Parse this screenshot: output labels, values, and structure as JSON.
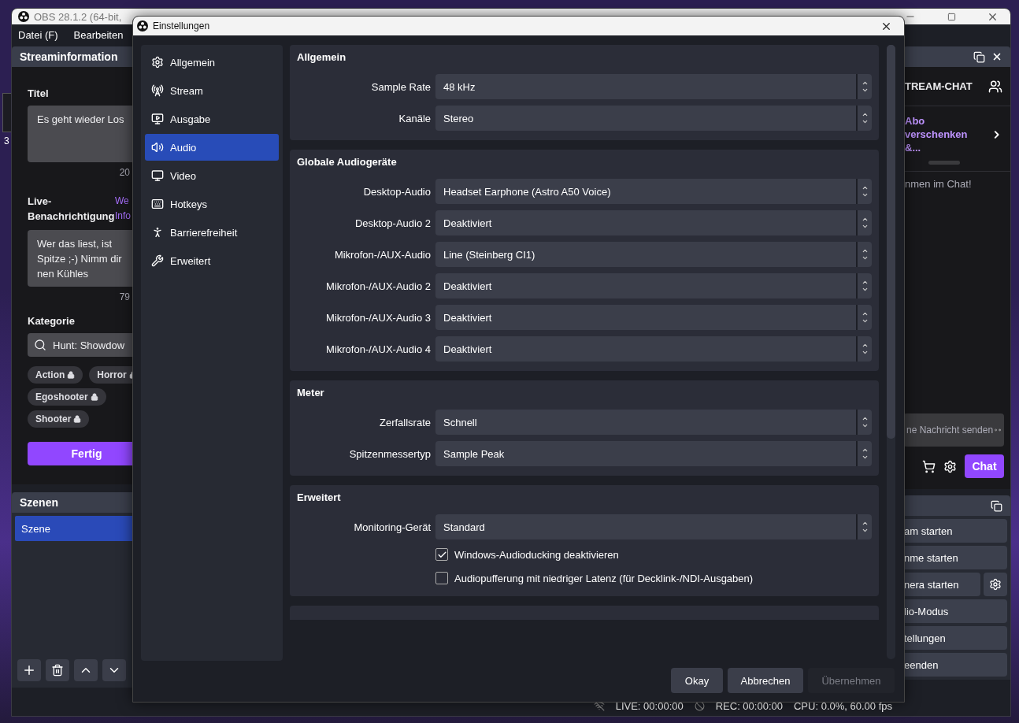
{
  "desktop": {
    "icon_label": "3"
  },
  "obs_window": {
    "title": "OBS 28.1.2 (64-bit,",
    "menu": [
      "Datei (F)",
      "Bearbeiten"
    ],
    "stream_info": {
      "title": "Streaminformation",
      "title_label": "Titel",
      "title_value": "Es geht wieder Los",
      "title_count": "20",
      "notification_label": "Live-Benachrichtigung",
      "notification_links": [
        "We",
        "Info"
      ],
      "notification_value": "Wer das liest, ist Spitze ;-) Nimm dir nen Kühles",
      "notification_count": "79",
      "category_label": "Kategorie",
      "category_value": "Hunt: Showdow",
      "tags": [
        "Action",
        "Horror",
        "Egoshooter",
        "Shooter"
      ],
      "done_button": "Fertig"
    },
    "scenes": {
      "title": "Szenen",
      "items": [
        {
          "label": "Szene",
          "selected": true
        }
      ]
    },
    "chat": {
      "title": "TREAM-CHAT",
      "promo": "Abo verschenken &...",
      "welcome": "nmen im Chat!",
      "placeholder": "ne Nachricht senden",
      "chat_button": "Chat"
    },
    "controls": {
      "buttons": [
        {
          "label": "am starten",
          "has_settings": false
        },
        {
          "label": "nme starten",
          "has_settings": false
        },
        {
          "label": "nera starten",
          "has_settings": true
        },
        {
          "label": "lio-Modus",
          "has_settings": false
        },
        {
          "label": "tellungen",
          "has_settings": false
        },
        {
          "label": "eenden",
          "has_settings": false
        }
      ]
    },
    "status_bar": {
      "live": "LIVE: 00:00:00",
      "rec": "REC: 00:00:00",
      "cpu": "CPU: 0.0%, 60.00 fps"
    }
  },
  "dialog": {
    "title": "Einstellungen",
    "sidebar": [
      {
        "label": "Allgemein",
        "kind": "gear",
        "selected": false
      },
      {
        "label": "Stream",
        "kind": "antenna",
        "selected": false
      },
      {
        "label": "Ausgabe",
        "kind": "output",
        "selected": false
      },
      {
        "label": "Audio",
        "kind": "speaker",
        "selected": true
      },
      {
        "label": "Video",
        "kind": "monitor",
        "selected": false
      },
      {
        "label": "Hotkeys",
        "kind": "keyboard",
        "selected": false
      },
      {
        "label": "Barrierefreiheit",
        "kind": "accessibility",
        "selected": false
      },
      {
        "label": "Erweitert",
        "kind": "tools",
        "selected": false
      }
    ],
    "sections": [
      {
        "title": "Allgemein",
        "rows": [
          {
            "kind": "select",
            "label": "Sample Rate",
            "value": "48 kHz"
          },
          {
            "kind": "select",
            "label": "Kanäle",
            "value": "Stereo"
          }
        ]
      },
      {
        "title": "Globale Audiogeräte",
        "rows": [
          {
            "kind": "select",
            "label": "Desktop-Audio",
            "value": "Headset Earphone (Astro A50 Voice)"
          },
          {
            "kind": "select",
            "label": "Desktop-Audio 2",
            "value": "Deaktiviert"
          },
          {
            "kind": "select",
            "label": "Mikrofon-/AUX-Audio",
            "value": "Line (Steinberg CI1)"
          },
          {
            "kind": "select",
            "label": "Mikrofon-/AUX-Audio 2",
            "value": "Deaktiviert"
          },
          {
            "kind": "select",
            "label": "Mikrofon-/AUX-Audio 3",
            "value": "Deaktiviert"
          },
          {
            "kind": "select",
            "label": "Mikrofon-/AUX-Audio 4",
            "value": "Deaktiviert"
          }
        ]
      },
      {
        "title": "Meter",
        "rows": [
          {
            "kind": "select",
            "label": "Zerfallsrate",
            "value": "Schnell"
          },
          {
            "kind": "select",
            "label": "Spitzenmessertyp",
            "value": "Sample Peak"
          }
        ]
      },
      {
        "title": "Erweitert",
        "rows": [
          {
            "kind": "select",
            "label": "Monitoring-Gerät",
            "value": "Standard"
          },
          {
            "kind": "checkbox",
            "label": "Windows-Audioducking deaktivieren",
            "checked": true
          },
          {
            "kind": "checkbox",
            "label": "Audiopufferung mit niedriger Latenz (für Decklink-/NDI-Ausgaben)",
            "checked": false
          }
        ]
      }
    ],
    "buttons": [
      {
        "label": "Okay",
        "disabled": false
      },
      {
        "label": "Abbrechen",
        "disabled": false
      },
      {
        "label": "Übernehmen",
        "disabled": true
      }
    ]
  }
}
